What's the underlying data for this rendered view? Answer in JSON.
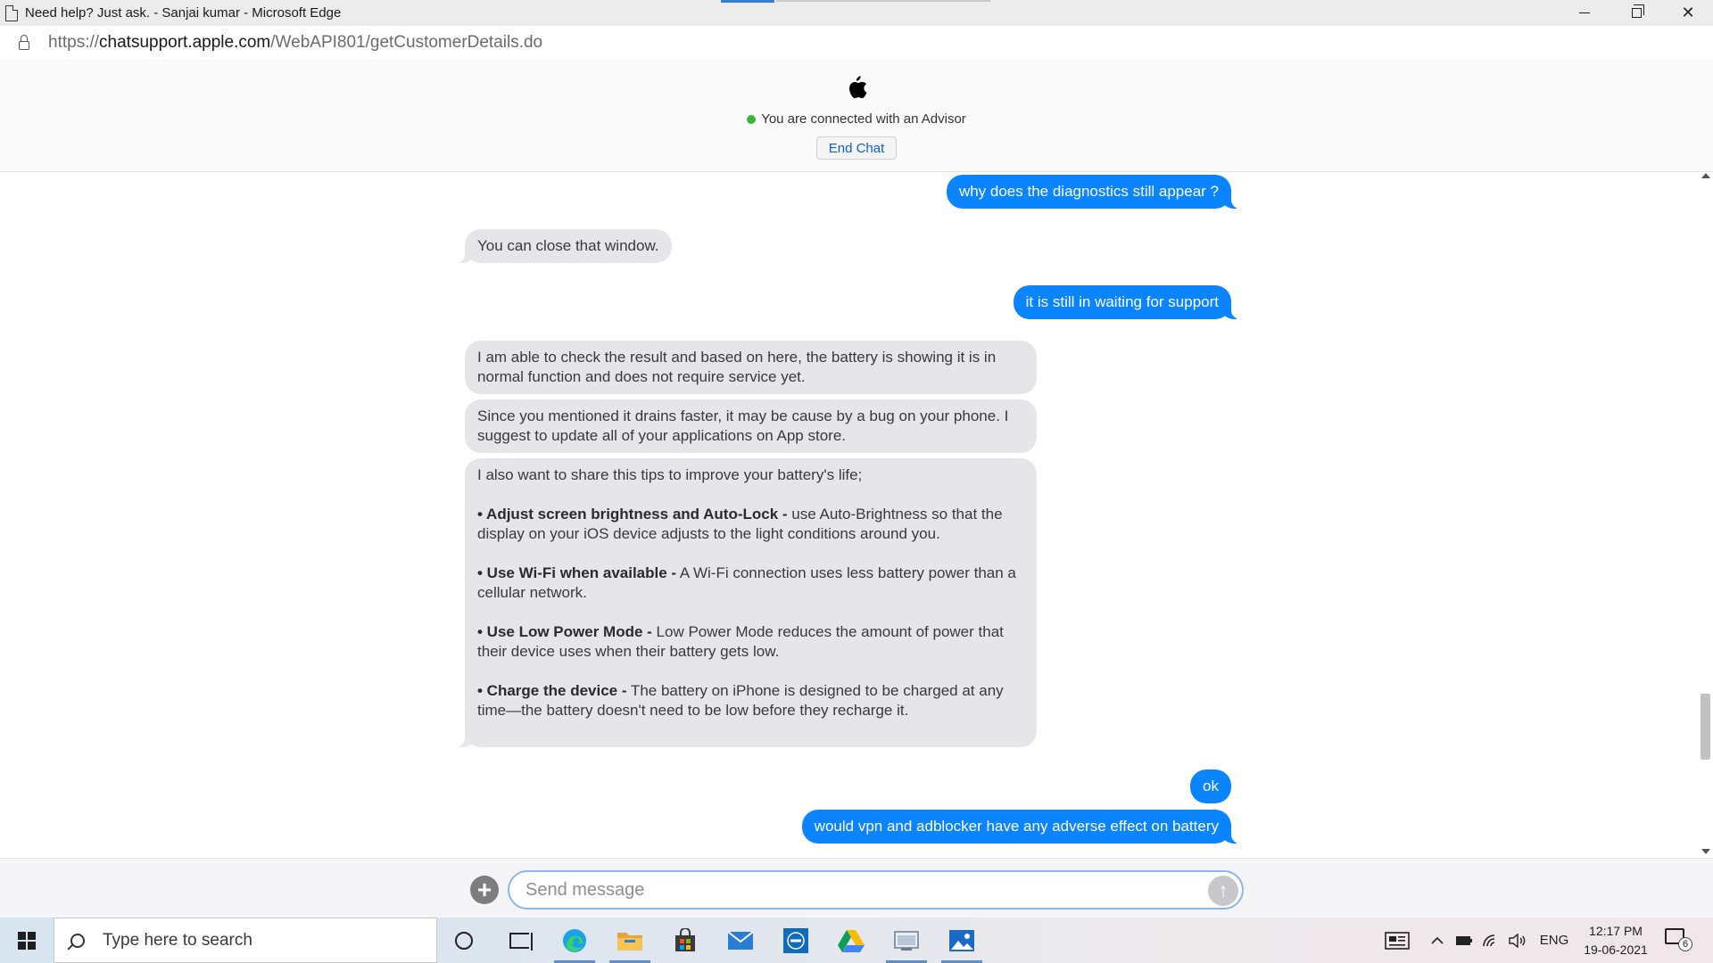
{
  "window": {
    "title": "Need help? Just ask. - Sanjai kumar - Microsoft Edge"
  },
  "address": {
    "prefix": "https://",
    "host": "chatsupport.apple.com",
    "path": "/WebAPI801/getCustomerDetails.do"
  },
  "chat_header": {
    "status": "You are connected with an Advisor",
    "end_chat_label": "End Chat"
  },
  "messages": {
    "m1": "why does the diagnostics still appear ?",
    "m2": "You can close that window.",
    "m3": "it is still in waiting for support",
    "m4": "I am able to check the result and based on here, the battery is showing it is in normal function and does not require service yet.",
    "m5": "Since you mentioned it drains faster, it may be cause by a bug on your phone. I suggest to update all of your applications on App store.",
    "m6_intro": "I also want to share this tips to improve your battery's life;",
    "tips": [
      {
        "title": "• Adjust screen brightness and Auto-Lock -",
        "text": " use Auto-Brightness so that the display on your iOS device adjusts to the light conditions around you."
      },
      {
        "title": "• Use Wi-Fi when available -",
        "text": " A Wi-Fi connection uses less battery power than a cellular network."
      },
      {
        "title": "• Use Low Power Mode -",
        "text": " Low Power Mode reduces the amount of power that their device uses when their battery gets low."
      },
      {
        "title": "• Charge the device -",
        "text": " The battery on iPhone is designed to be charged at any time—the battery doesn't need to be low before they recharge it."
      }
    ],
    "m7": "ok",
    "m8": "would vpn and adblocker have any adverse effect on battery"
  },
  "compose": {
    "placeholder": "Send message",
    "plus_glyph": "+",
    "send_glyph": "↑"
  },
  "taskbar": {
    "search_placeholder": "Type here to search",
    "language": "ENG",
    "time": "12:17 PM",
    "date": "19-06-2021",
    "notification_count": "6"
  },
  "colors": {
    "outgoing_bubble": "#0a84ff",
    "incoming_bubble": "#e5e5ea",
    "status_dot": "#3cb43c",
    "link_blue": "#0b62c7"
  }
}
